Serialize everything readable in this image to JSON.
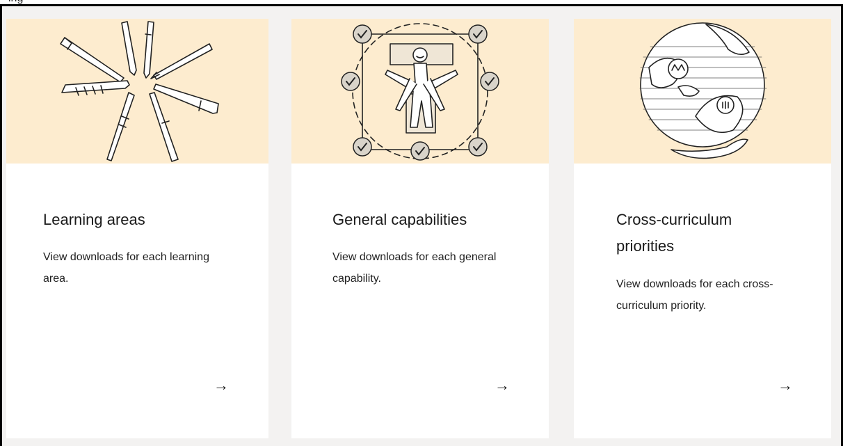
{
  "top_strip_text": "ing",
  "cards": [
    {
      "title": "Learning areas",
      "description": "View downloads for each learning area.",
      "illustration": "pens-circle-icon",
      "arrow": "→"
    },
    {
      "title": "General capabilities",
      "description": "View downloads for each general capability.",
      "illustration": "figure-checkmarks-icon",
      "arrow": "→"
    },
    {
      "title": "Cross-curriculum priorities",
      "description": "View downloads for each cross-curriculum priority.",
      "illustration": "globe-in-hand-icon",
      "arrow": "→"
    }
  ],
  "colors": {
    "page_background": "#f3f2f1",
    "card_background": "#ffffff",
    "illustration_background": "#fdeccf",
    "border": "#000000",
    "text": "#1a1a1a"
  }
}
